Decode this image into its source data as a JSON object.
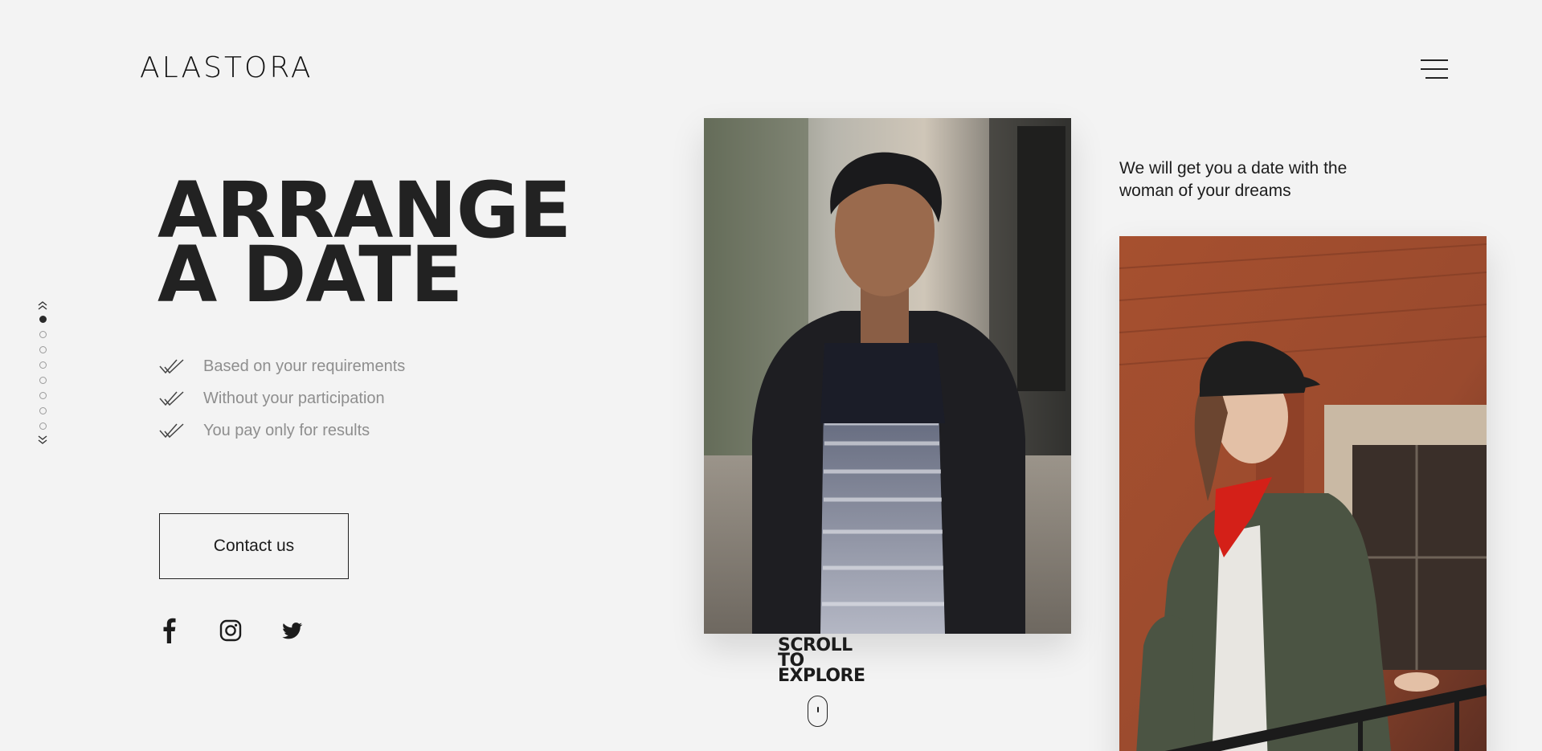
{
  "brand": {
    "logo": "ALASTORA"
  },
  "nav": {
    "menu_icon": "hamburger-menu-icon"
  },
  "pager": {
    "dots": 8,
    "active_index": 0,
    "up_icon": "chevrons-up-icon",
    "down_icon": "chevrons-down-icon"
  },
  "hero": {
    "title_line1": "ARRANGE",
    "title_line2": "A DATE",
    "features": [
      "Based on your requirements",
      "Without your participation",
      "You pay only for results"
    ],
    "contact_label": "Contact us"
  },
  "social": [
    "facebook-icon",
    "instagram-icon",
    "twitter-icon"
  ],
  "tagline": "We will get you a date with the woman of your dreams",
  "scroll": {
    "line1": "SCROLL",
    "line2": "TO",
    "line3": "EXPLORE"
  },
  "colors": {
    "background": "#f3f3f3",
    "text": "#1c1c1c",
    "muted": "#8e8e8e"
  }
}
